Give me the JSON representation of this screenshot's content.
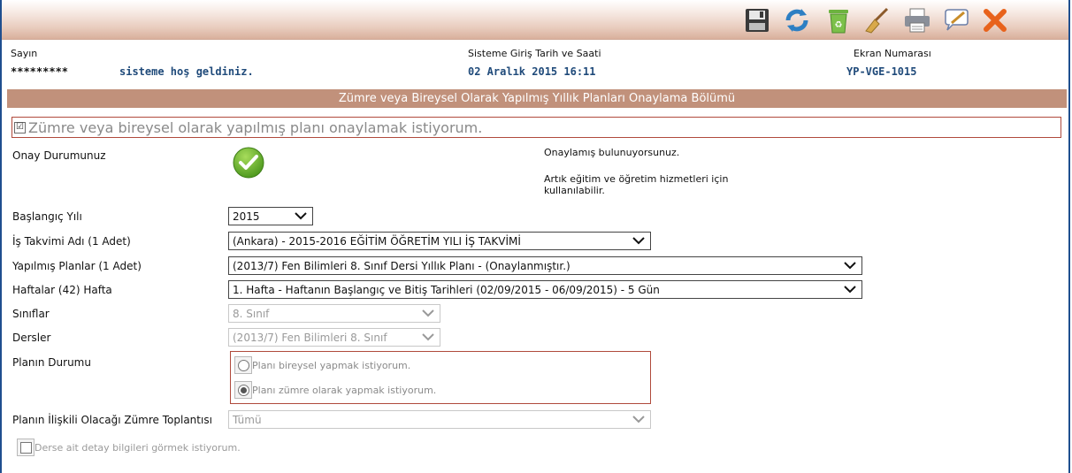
{
  "toolbar": {
    "icons": [
      "save-icon",
      "refresh-icon",
      "recycle-bin-icon",
      "broom-icon",
      "printer-icon",
      "comment-icon",
      "close-icon"
    ]
  },
  "header": {
    "greeting_label": "Sayın",
    "user_stars": "*********",
    "welcome": "sisteme hoş geldiniz.",
    "login_label": "Sisteme Giriş Tarih ve Saati",
    "login_value": "02 Aralık 2015 16:11",
    "screen_label": "Ekran Numarası",
    "screen_value": "YP-VGE-1015"
  },
  "section": {
    "title": "Zümre veya Bireysel Olarak Yapılmış Yıllık Planları Onaylama Bölümü"
  },
  "confirm": {
    "checked": true,
    "label": "Zümre veya bireysel olarak yapılmış planı onaylamak istiyorum."
  },
  "approval": {
    "label": "Onay Durumunuz",
    "status_icon": "check-circle-icon",
    "message_1": "Onaylamış bulunuyorsunuz.",
    "message_2": "Artık eğitim ve öğretim hizmetleri için kullanılabilir."
  },
  "form": {
    "start_year_label": "Başlangıç Yılı",
    "start_year_value": "2015",
    "calendar_label": "İş Takvimi Adı (1 Adet)",
    "calendar_value": "(Ankara) - 2015-2016 EĞİTİM ÖĞRETİM YILI İŞ TAKVİMİ",
    "plans_label": "Yapılmış Planlar (1 Adet)",
    "plans_value": "(2013/7) Fen Bilimleri 8. Sınıf Dersi Yıllık Planı - (Onaylanmıştır.)",
    "weeks_label": "Haftalar (42) Hafta",
    "weeks_value": "1. Hafta - Haftanın Başlangıç ve Bitiş Tarihleri (02/09/2015 - 06/09/2015) - 5 Gün",
    "classes_label": "Sınıflar",
    "classes_value": "8. Sınıf",
    "lessons_label": "Dersler",
    "lessons_value": "(2013/7) Fen Bilimleri 8. Sınıf",
    "plan_status_label": "Planın Durumu",
    "radio_individual": "Planı bireysel yapmak istiyorum.",
    "radio_group": "Planı zümre olarak yapmak istiyorum.",
    "radio_selected": "group",
    "meeting_label": "Planın İlişkili Olacağı Zümre Toplantısı",
    "meeting_value": "Tümü",
    "detail_label": "Derse ait detay bilgileri görmek istiyorum."
  }
}
